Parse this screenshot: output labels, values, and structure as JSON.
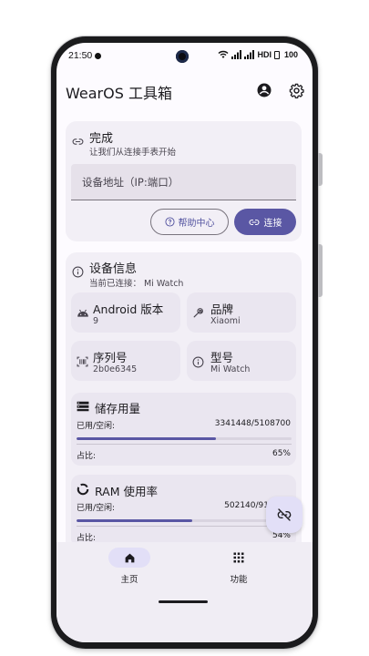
{
  "status_bar": {
    "time": "21:50",
    "right_text": "HDI",
    "battery": "100",
    "icons": [
      "notification-dot-icon",
      "wifi-icon",
      "signal-icon",
      "signal-icon",
      "battery-icon"
    ]
  },
  "app_bar": {
    "title": "WearOS 工具箱",
    "icons": [
      "account-circle-icon",
      "settings-gear-icon"
    ]
  },
  "connect_card": {
    "title": "完成",
    "subtitle": "让我们从连接手表开始",
    "input_placeholder": "设备地址（IP:端口）",
    "help_button": "帮助中心",
    "connect_button": "连接"
  },
  "device_info": {
    "title": "设备信息",
    "subtitle": "当前已连接：  Mi Watch",
    "tiles": [
      {
        "title": "Android 版本",
        "value": "9",
        "icon": "android-icon"
      },
      {
        "title": "品牌",
        "value": "Xiaomi",
        "icon": "build-wrench-icon"
      },
      {
        "title": "序列号",
        "value": "2b0e6345",
        "icon": "barcode-icon"
      },
      {
        "title": "型号",
        "value": "Mi Watch",
        "icon": "info-icon"
      }
    ],
    "storage": {
      "title": "储存用量",
      "used_label": "已用/空闲:",
      "used_value": "3341448/5108700",
      "ratio_label": "占比:",
      "ratio_value": "65%",
      "fraction": 0.65
    },
    "ram": {
      "title": "RAM 使用率",
      "used_label": "已用/空闲:",
      "used_value": "502140/91",
      "ratio_label": "占比:",
      "ratio_value": "54%",
      "fraction": 0.54
    }
  },
  "fab": {
    "icon": "link-off-icon"
  },
  "bottom_nav": {
    "items": [
      {
        "label": "主页",
        "icon": "home-icon",
        "active": true
      },
      {
        "label": "功能",
        "icon": "apps-grid-icon",
        "active": false
      }
    ]
  },
  "colors": {
    "accent": "#5a57a4",
    "card_bg": "#f2eff6",
    "subcard_bg": "#eae6f0",
    "nav_indicator": "#e2dff7"
  }
}
